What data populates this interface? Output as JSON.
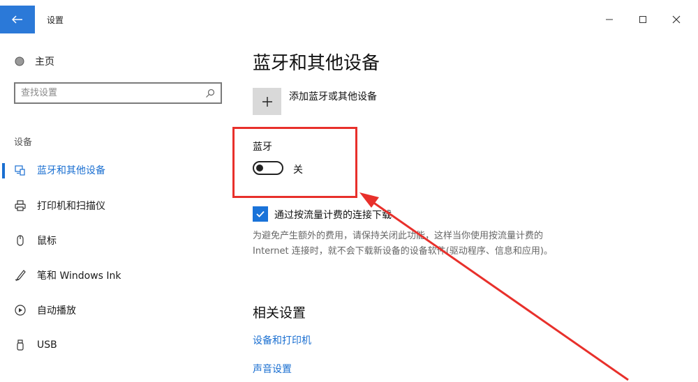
{
  "window": {
    "title": "设置",
    "back_icon": "back-arrow-icon",
    "controls": [
      "minimize-icon",
      "maximize-icon",
      "close-icon"
    ],
    "accent_color": "#2b79d8",
    "highlight_color": "#e8302b"
  },
  "sidebar": {
    "home_label": "主页",
    "search": {
      "placeholder": "查找设置"
    },
    "section_label": "设备",
    "items": [
      {
        "label": "蓝牙和其他设备",
        "icon": "bluetooth-devices-icon",
        "active": true
      },
      {
        "label": "打印机和扫描仪",
        "icon": "printer-icon",
        "active": false
      },
      {
        "label": "鼠标",
        "icon": "mouse-icon",
        "active": false
      },
      {
        "label": "笔和 Windows Ink",
        "icon": "pen-icon",
        "active": false
      },
      {
        "label": "自动播放",
        "icon": "autoplay-icon",
        "active": false
      },
      {
        "label": "USB",
        "icon": "usb-icon",
        "active": false
      }
    ]
  },
  "main": {
    "title": "蓝牙和其他设备",
    "add_device_label": "添加蓝牙或其他设备",
    "bluetooth_label": "蓝牙",
    "bluetooth_state": "关",
    "metered_checkbox_label": "通过按流量计费的连接下载",
    "metered_checked": true,
    "metered_description": "为避免产生额外的费用，请保持关闭此功能，这样当你使用按流量计费的 Internet 连接时，就不会下载新设备的设备软件(驱动程序、信息和应用)。",
    "related_title": "相关设置",
    "links": [
      "设备和打印机",
      "声音设置"
    ]
  }
}
